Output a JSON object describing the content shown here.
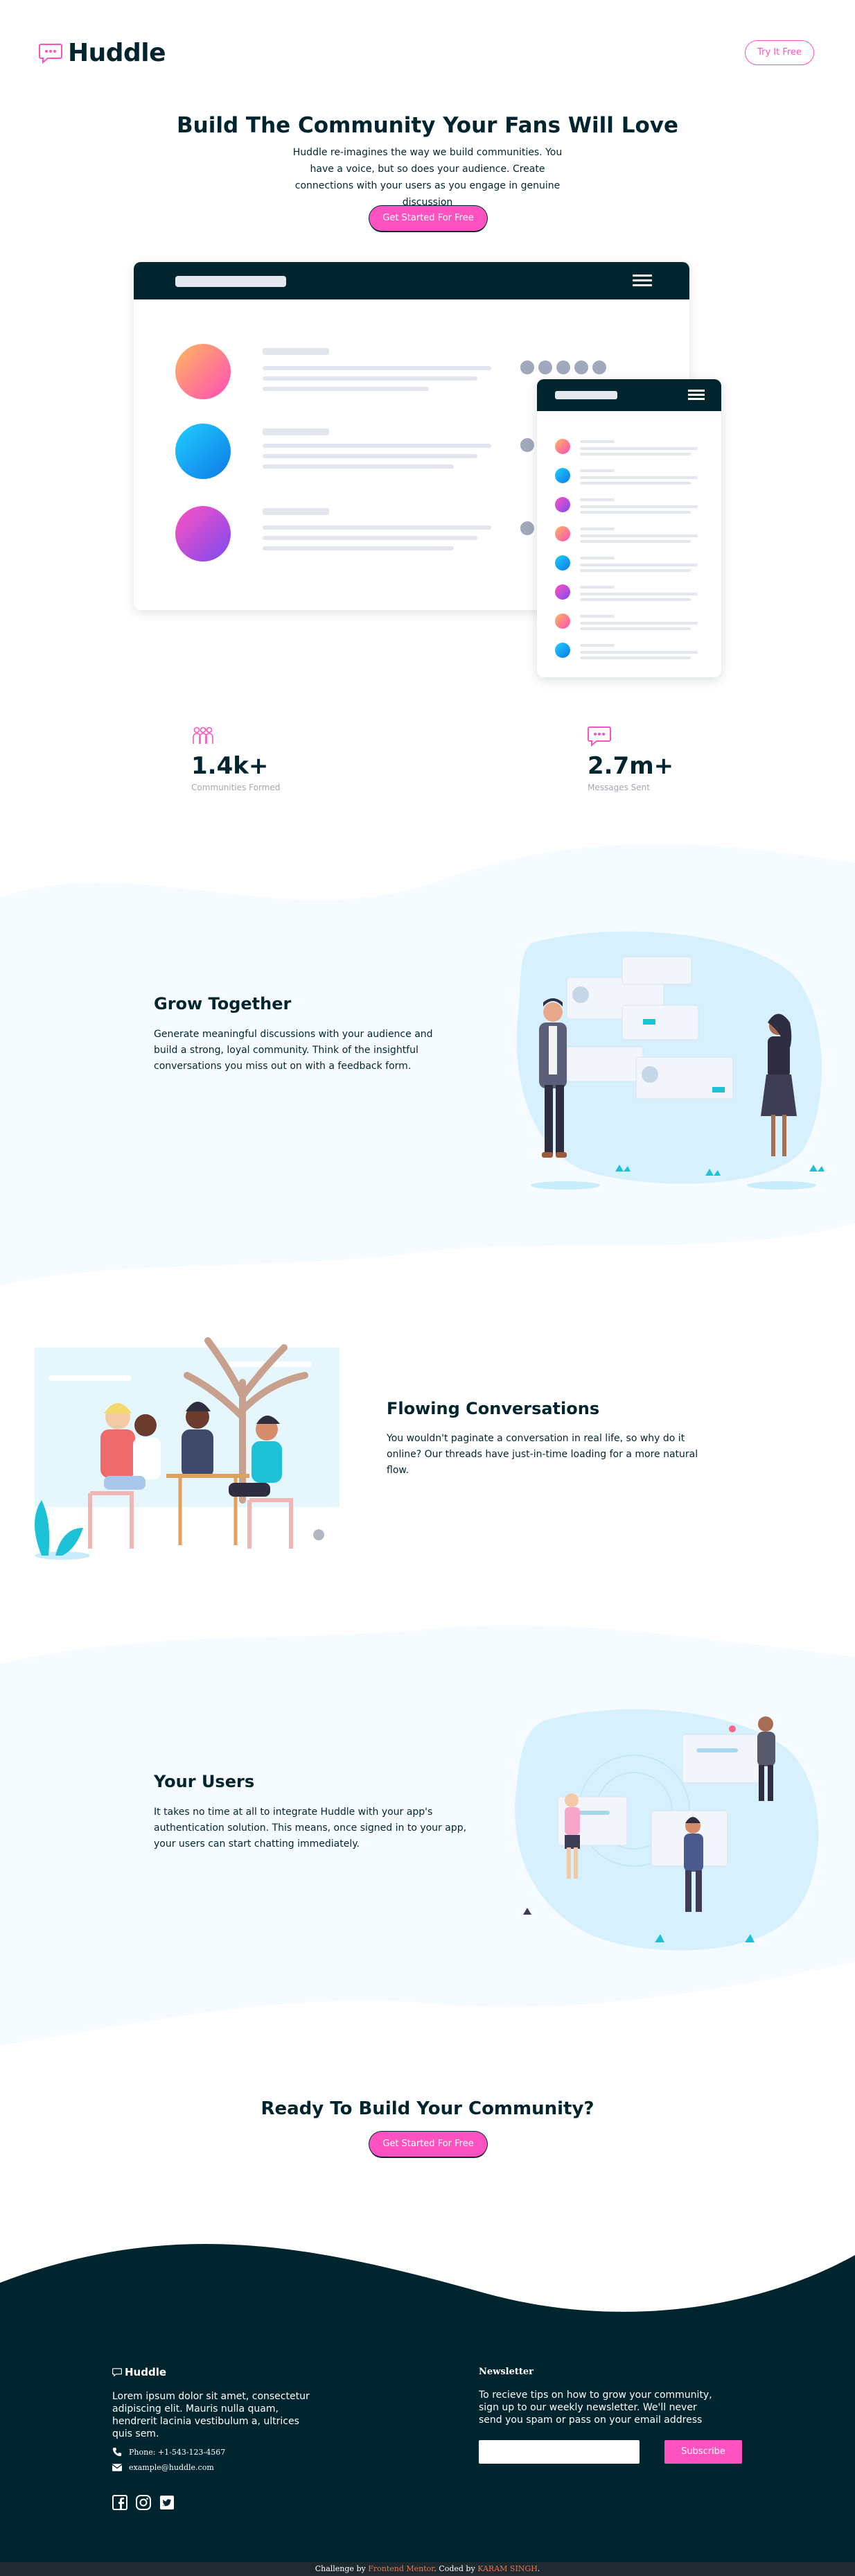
{
  "brand": {
    "name": "Huddle",
    "accent": "#ff52c1",
    "dark": "#00252e"
  },
  "header": {
    "try_label": "Try It Free"
  },
  "hero": {
    "title": "Build The Community Your Fans Will Love",
    "description": "Huddle re-imagines the way we build communities. You have a voice, but so does your audience. Create connections with your users as you engage in genuine discussion",
    "cta_label": "Get Started For Free"
  },
  "stats": [
    {
      "icon": "communities-icon",
      "value": "1.4k+",
      "label": "Communities Formed"
    },
    {
      "icon": "messages-icon",
      "value": "2.7m+",
      "label": "Messages Sent"
    }
  ],
  "features": [
    {
      "title": "Grow Together",
      "text": "Generate meaningful discussions with your audience and build a strong, loyal community. Think of the insightful conversations you miss out on with a feedback form."
    },
    {
      "title": "Flowing Conversations",
      "text": "You wouldn't paginate a conversation in real life, so why do it online? Our threads have just-in-time loading for a more natural flow."
    },
    {
      "title": "Your Users",
      "text": "It takes no time at all to integrate Huddle with your app's authentication solution. This means, once signed in to your app, your users can start chatting immediately."
    }
  ],
  "ready": {
    "title": "Ready To Build Your Community?",
    "cta_label": "Get Started For Free"
  },
  "footer": {
    "logo": "Huddle",
    "description": "Lorem ipsum dolor sit amet, consectetur adipiscing elit. Mauris nulla quam, hendrerit lacinia vestibulum a, ultrices quis sem.",
    "phone": "Phone: +1-543-123-4567",
    "email": "example@huddle.com",
    "social": [
      "facebook-icon",
      "instagram-icon",
      "twitter-icon"
    ],
    "newsletter_title": "Newsletter",
    "newsletter_desc": "To recieve tips on how to grow your community, sign up to our weekly newsletter. We'll never send you spam or pass on your email address",
    "newsletter_placeholder": "",
    "subscribe_label": "Subscribe"
  },
  "attribution": {
    "prefix": "Challenge by",
    "fm": "Frontend Mentor",
    "mid": ". Coded by",
    "author": "KARAM SINGH",
    "suffix": "."
  }
}
